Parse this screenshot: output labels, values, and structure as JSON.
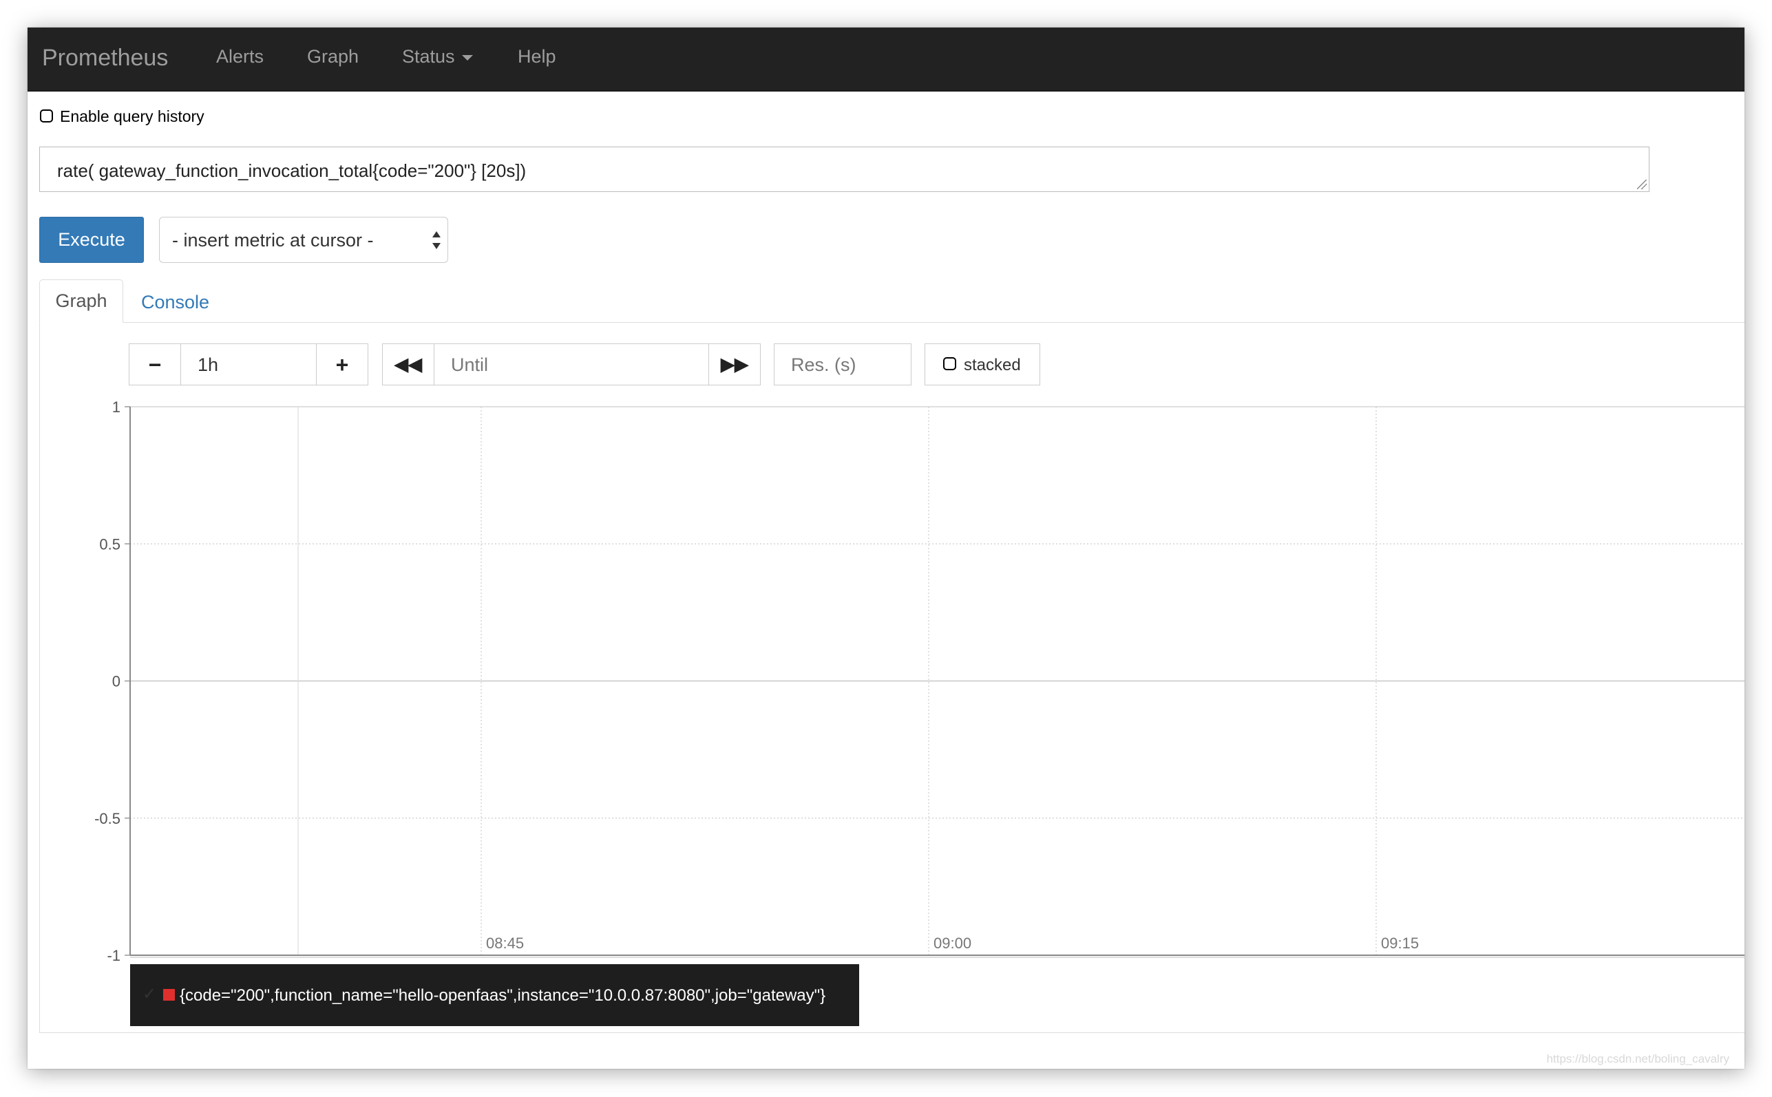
{
  "navbar": {
    "brand": "Prometheus",
    "items": [
      "Alerts",
      "Graph",
      "Status",
      "Help"
    ]
  },
  "query_history": {
    "label": "Enable query history",
    "checked": false
  },
  "query": {
    "expression": "rate( gateway_function_invocation_total{code=\"200\"} [20s])"
  },
  "toolbar": {
    "execute_label": "Execute",
    "metric_select": "- insert metric at cursor -"
  },
  "tabs": {
    "graph": "Graph",
    "console": "Console"
  },
  "graph_controls": {
    "minus_icon": "minus-icon",
    "range": "1h",
    "plus_icon": "plus-icon",
    "back_icon": "backward-icon",
    "until_placeholder": "Until",
    "forward_icon": "forward-icon",
    "resolution_placeholder": "Res. (s)",
    "stacked_label": "stacked",
    "stacked_checked": false
  },
  "chart_data": {
    "type": "line",
    "ylim": [
      -1,
      1
    ],
    "yticks": [
      1,
      0.5,
      0,
      -0.5,
      -1
    ],
    "xticks": [
      "08:45",
      "09:00",
      "09:15"
    ],
    "grid": true,
    "series": []
  },
  "legend": {
    "entries": [
      {
        "label": "{code=\"200\",function_name=\"hello-openfaas\",instance=\"10.0.0.87:8080\",job=\"gateway\"}",
        "color": "#e0302e"
      }
    ]
  },
  "watermark": "https://blog.csdn.net/boling_cavalry"
}
